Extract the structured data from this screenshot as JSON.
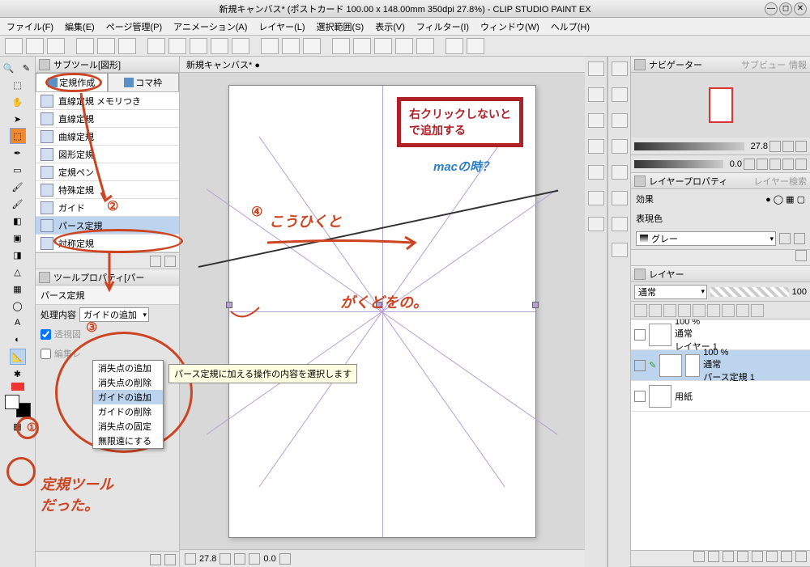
{
  "title": "新規キャンバス* (ポストカード 100.00 x 148.00mm 350dpi 27.8%)  -  CLIP STUDIO PAINT EX",
  "menu": [
    "ファイル(F)",
    "編集(E)",
    "ページ管理(P)",
    "アニメーション(A)",
    "レイヤー(L)",
    "選択範囲(S)",
    "表示(V)",
    "フィルター(I)",
    "ウィンドウ(W)",
    "ヘルプ(H)"
  ],
  "doc_tab": "新規キャンバス* ●",
  "subtool_title": "サブツール[図形]",
  "subtool_tabs": {
    "a": "定規作成",
    "b": "コマ枠"
  },
  "subtool_items": [
    "直線定規 メモリつき",
    "直線定規",
    "曲線定規",
    "図形定規",
    "定規ペン",
    "特殊定規",
    "ガイド",
    "パース定規",
    "対称定規"
  ],
  "toolprop_title": "ツールプロパティ[パー",
  "toolprop_sub": "パース定規",
  "toolprop_label": "処理内容",
  "toolprop_value": "ガイドの追加",
  "toolprop_chk1": "透視図",
  "toolprop_chk2": "編集レ",
  "popup_items": [
    "消失点の追加",
    "消失点の削除",
    "ガイドの追加",
    "ガイドの削除",
    "消失点の固定",
    "無限遠にする"
  ],
  "tooltip": "パース定規に加える操作の内容を選択します",
  "nav_title": "ナビゲーター",
  "nav_tab2": "サブビュー",
  "nav_tab3": "情報",
  "zoom": "27.8",
  "rotation": "0.0",
  "layerprop_title": "レイヤープロパティ",
  "layerprop_tab2": "レイヤー検索",
  "layerprop_effect": "効果",
  "layerprop_expr": "表現色",
  "layerprop_gray": "グレー",
  "layers_title": "レイヤー",
  "blend_mode": "通常",
  "opacity": "100",
  "layers": [
    {
      "opacity": "100 %",
      "mode": "通常",
      "name": "レイヤー 1"
    },
    {
      "opacity": "100 %",
      "mode": "通常",
      "name": "パース定規 1"
    },
    {
      "opacity": "",
      "mode": "",
      "name": "用紙"
    }
  ],
  "canvas_zoom": "27.8",
  "canvas_rot": "0.0",
  "annot": {
    "num1": "①",
    "num2": "②",
    "num3": "③",
    "num4": "④",
    "box": "右クリックしないと\nで追加する",
    "mac": "macの時？",
    "kou": "こうひくと",
    "gakudo": "がくどをの。",
    "ruler": "定規ツール\nだった。"
  }
}
